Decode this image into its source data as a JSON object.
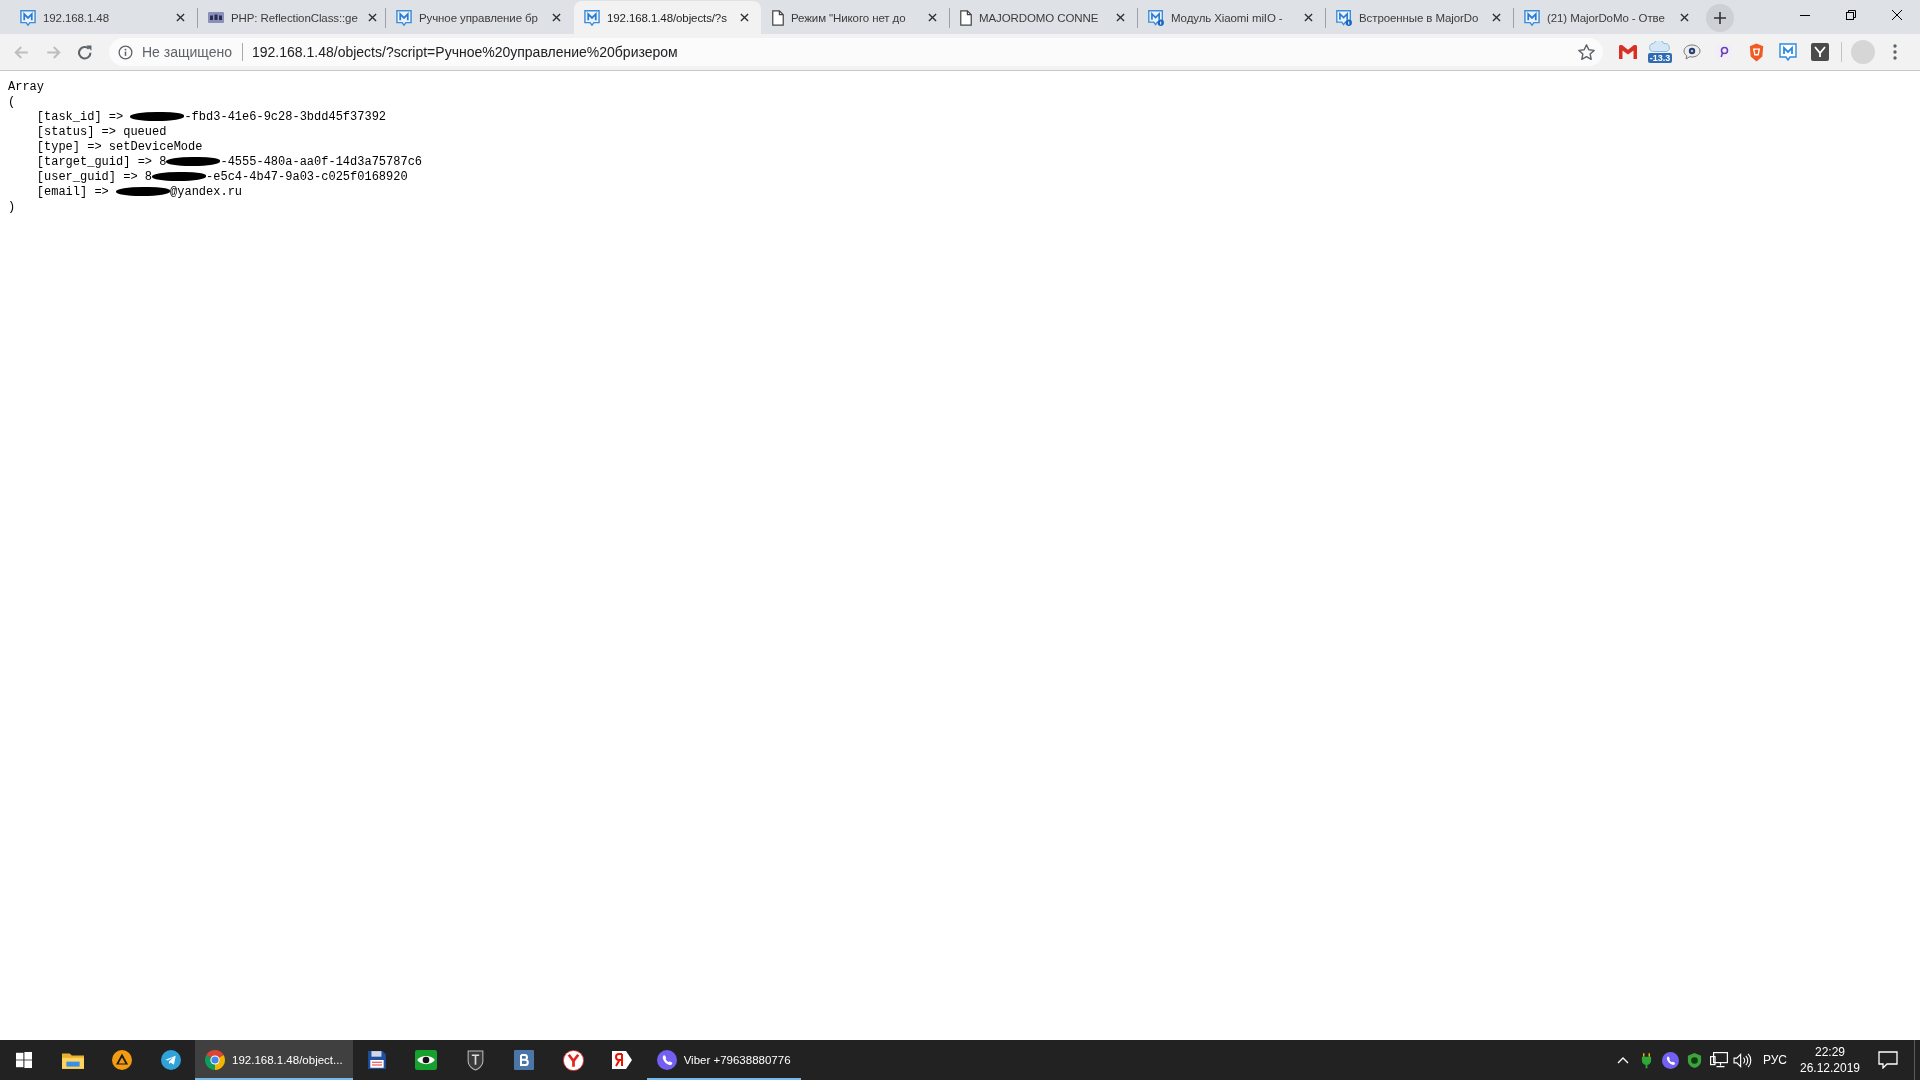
{
  "browser": {
    "tabs": [
      {
        "kind": "majordomo",
        "title": "192.168.1.48",
        "selected": false
      },
      {
        "kind": "php",
        "title": "PHP: ReflectionClass::ge",
        "selected": false
      },
      {
        "kind": "majordomo",
        "title": "Ручное управление бр",
        "selected": false
      },
      {
        "kind": "majordomo",
        "title": "192.168.1.48/objects/?s",
        "selected": true
      },
      {
        "kind": "document",
        "title": "Режим \"Никого нет до",
        "selected": false
      },
      {
        "kind": "document",
        "title": "MAJORDOMO CONNE",
        "selected": false
      },
      {
        "kind": "majordomo-info",
        "title": "Модуль Xiaomi miIO -",
        "selected": false
      },
      {
        "kind": "majordomo-info",
        "title": "Встроенные в MajorDo",
        "selected": false
      },
      {
        "kind": "majordomo",
        "title": "(21) MajorDoMo - Отве",
        "selected": false
      }
    ],
    "toolbar": {
      "nav_buttons": [
        {
          "kind": "back",
          "disabled": true
        },
        {
          "kind": "forward",
          "disabled": true
        },
        {
          "kind": "reload",
          "disabled": false
        }
      ],
      "address_bar": {
        "security_label": "Не защищено",
        "url": "192.168.1.48/objects/?script=Ручное%20управление%20бризером"
      },
      "extensions": [
        {
          "kind": "mail"
        },
        {
          "kind": "weather",
          "badge": "-13.3"
        },
        {
          "kind": "chat"
        },
        {
          "kind": "search"
        },
        {
          "kind": "shield"
        },
        {
          "kind": "m-tile"
        },
        {
          "kind": "dark-tile"
        }
      ]
    }
  },
  "page": {
    "header": "Array",
    "open": "(",
    "entries": [
      {
        "key": "[task_id]",
        "arrow": "=>",
        "value": [
          {
            "kind": "redaction"
          },
          {
            "kind": "text",
            "text": "-fbd3-41e6-9c28-3bdd45f37392"
          }
        ]
      },
      {
        "key": "[status]",
        "arrow": "=>",
        "value": [
          {
            "kind": "text",
            "text": "queued"
          }
        ]
      },
      {
        "key": "[type]",
        "arrow": "=>",
        "value": [
          {
            "kind": "text",
            "text": "setDeviceMode"
          }
        ]
      },
      {
        "key": "[target_guid]",
        "arrow": "=>",
        "value": [
          {
            "kind": "text",
            "text": "8"
          },
          {
            "kind": "redaction"
          },
          {
            "kind": "text",
            "text": "-4555-480a-aa0f-14d3a75787c6"
          }
        ]
      },
      {
        "key": "[user_guid]",
        "arrow": "=>",
        "value": [
          {
            "kind": "text",
            "text": "8"
          },
          {
            "kind": "redaction"
          },
          {
            "kind": "text",
            "text": "-e5c4-4b47-9a03-c025f0168920"
          }
        ]
      },
      {
        "key": "[email]",
        "arrow": "=>",
        "value": [
          {
            "kind": "redaction"
          },
          {
            "kind": "text",
            "text": "@yandex.ru"
          }
        ]
      }
    ],
    "close": ")"
  },
  "taskbar": {
    "items": [
      {
        "kind": "start",
        "selected": false,
        "running": false
      },
      {
        "kind": "folder",
        "selected": false,
        "running": false
      },
      {
        "kind": "player",
        "selected": false,
        "running": false
      },
      {
        "kind": "plane",
        "selected": false,
        "running": false
      },
      {
        "kind": "browser",
        "label": "192.168.1.48/object...",
        "selected": true,
        "running": true
      },
      {
        "kind": "floppy",
        "selected": false,
        "running": false
      },
      {
        "kind": "eye",
        "selected": false,
        "running": false
      },
      {
        "kind": "tank-shield",
        "selected": false,
        "running": false
      },
      {
        "kind": "b-tile",
        "selected": false,
        "running": false
      },
      {
        "kind": "y-circle",
        "selected": false,
        "running": false
      },
      {
        "kind": "ya-tag",
        "selected": false,
        "running": false
      },
      {
        "kind": "viber",
        "label": "Viber +79638880776",
        "selected": false,
        "running": true
      }
    ],
    "tray": {
      "icons": [
        {
          "kind": "chevron"
        },
        {
          "kind": "plug"
        },
        {
          "kind": "phone"
        },
        {
          "kind": "shield"
        },
        {
          "kind": "network"
        },
        {
          "kind": "volume"
        }
      ],
      "language": "РУС",
      "time": "22:29",
      "date": "26.12.2019"
    }
  }
}
